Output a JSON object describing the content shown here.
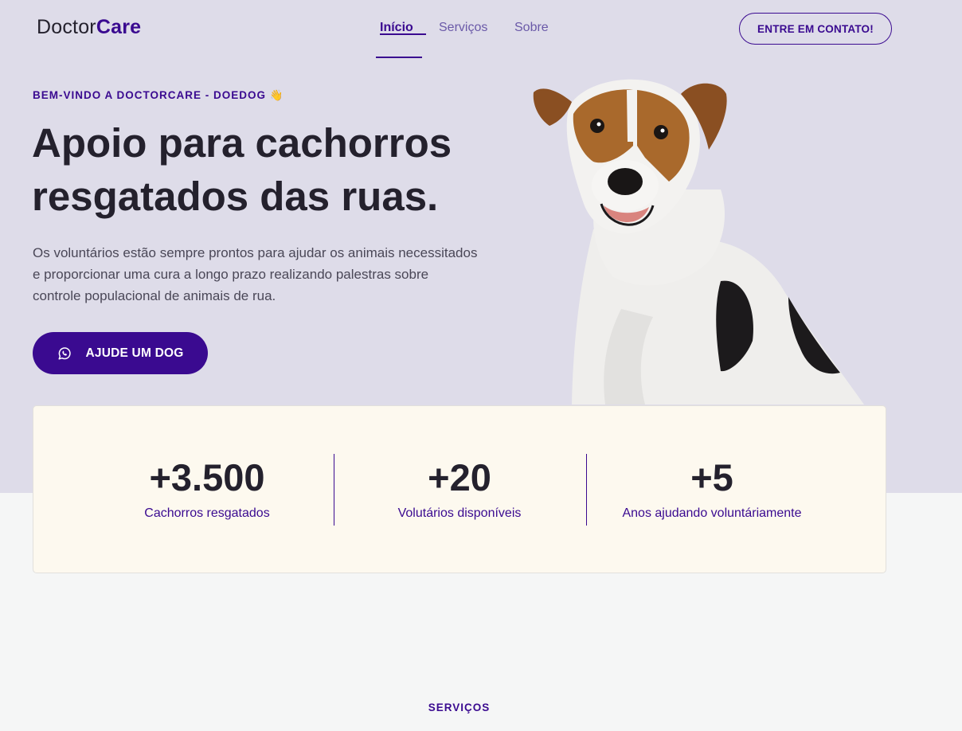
{
  "header": {
    "logo_prefix": "Doctor",
    "logo_suffix": "Care",
    "nav": [
      "Início",
      "Serviços",
      "Sobre"
    ],
    "active_nav": "Início",
    "contact_button": "ENTRE EM CONTATO!"
  },
  "hero": {
    "welcome": "BEM-VINDO A DOCTORCARE - DOEDOG 👋",
    "title": "Apoio para cachorros resgatados das ruas.",
    "text": "Os voluntários estão sempre prontos para ajudar os animais necessitados e proporcionar uma cura a longo prazo realizando palestras sobre controle populacional de animais de rua.",
    "cta_label": "AJUDE UM DOG",
    "cta_icon": "whatsapp-icon",
    "image": "dog-photo"
  },
  "stats": [
    {
      "value": "+3.500",
      "label": "Cachorros resgatados"
    },
    {
      "value": "+20",
      "label": "Volutários disponíveis"
    },
    {
      "value": "+5",
      "label": "Anos ajudando voluntáriamente"
    }
  ],
  "services": {
    "label": "SERVIÇOS"
  },
  "colors": {
    "primary": "#3a0a90",
    "hero_bg": "#dedce9",
    "stats_bg": "#fdf9ef",
    "page_bg": "#f5f6f6",
    "text_dark": "#24212d"
  }
}
